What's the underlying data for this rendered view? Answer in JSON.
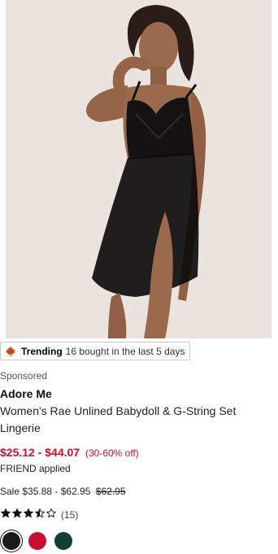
{
  "product": {
    "image_alt": "Women's Rae Unlined Babydoll & G-String Set Lingerie",
    "trending": {
      "icon": "maple-leaf-icon",
      "label": "Trending",
      "text": "16 bought in the last 5 days"
    },
    "sponsored": "Sponsored",
    "brand": "Adore Me",
    "name": "Women's Rae Unlined Babydoll & G-String Set Lingerie",
    "price": {
      "range": "$25.12 - $44.07",
      "discount": "(30-60% off)",
      "promo": "FRIEND applied",
      "sale_label": "Sale",
      "sale_range": "$35.88 - $62.95",
      "original": "$62.95",
      "color": "#c8102e"
    },
    "rating": {
      "stars": 3.5,
      "max": 5,
      "count": "(15)"
    },
    "swatches": [
      {
        "name": "black",
        "color": "#1a1a1a",
        "selected": true
      },
      {
        "name": "red",
        "color": "#c8102e",
        "selected": false
      },
      {
        "name": "dark-green",
        "color": "#0f3f36",
        "selected": false
      }
    ]
  }
}
